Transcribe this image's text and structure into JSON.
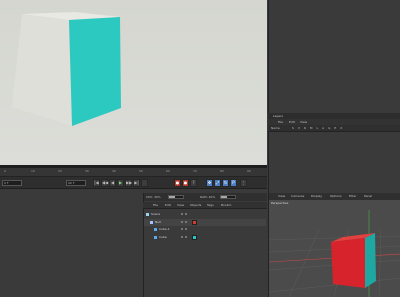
{
  "timeline": {
    "ticks": [
      "0",
      "10",
      "20",
      "30",
      "40",
      "50",
      "60",
      "70",
      "80",
      "90"
    ],
    "current_frame": "0 F",
    "start_field": "0 F",
    "end_field": "90 F"
  },
  "transport": {
    "first": "|◀",
    "prev_key": "◀◀",
    "prev": "◀",
    "play": "▶",
    "next": "▶▶",
    "last": "▶|"
  },
  "cpu": {
    "cpu_label": "CPU: 40%",
    "ram_label": "RAM: 40%",
    "cpu_level": 0.4,
    "ram_level": 0.4
  },
  "object_manager": {
    "menu": [
      "File",
      "Edit",
      "View",
      "Objects",
      "Tags",
      "Bookm"
    ],
    "rows": [
      {
        "label": "Scene",
        "indent": 0,
        "icon_color": "#9fd0f0",
        "material": ""
      },
      {
        "label": "Null",
        "indent": 1,
        "icon_color": "#a0c4ff",
        "material": "#d23b2f"
      },
      {
        "label": "Cube.1",
        "indent": 2,
        "icon_color": "#5fa8f0",
        "material": ""
      },
      {
        "label": "Cube",
        "indent": 2,
        "icon_color": "#5fa8f0",
        "material": "#29c7c2"
      }
    ]
  },
  "layers": {
    "title": "Layers",
    "menu": [
      "File",
      "Edit",
      "View"
    ],
    "name_col": "Name",
    "flags": "S V R M L A G E X"
  },
  "viewport2": {
    "menu": [
      "View",
      "Cameras",
      "Display",
      "Options",
      "Filter",
      "Panel"
    ],
    "label": "Perspective"
  },
  "colors": {
    "cube_side": "#2cc9c0",
    "cube_front_gray": "#e6e6df",
    "cube_red": "#d7232c",
    "accent": "#4d7fc4"
  }
}
